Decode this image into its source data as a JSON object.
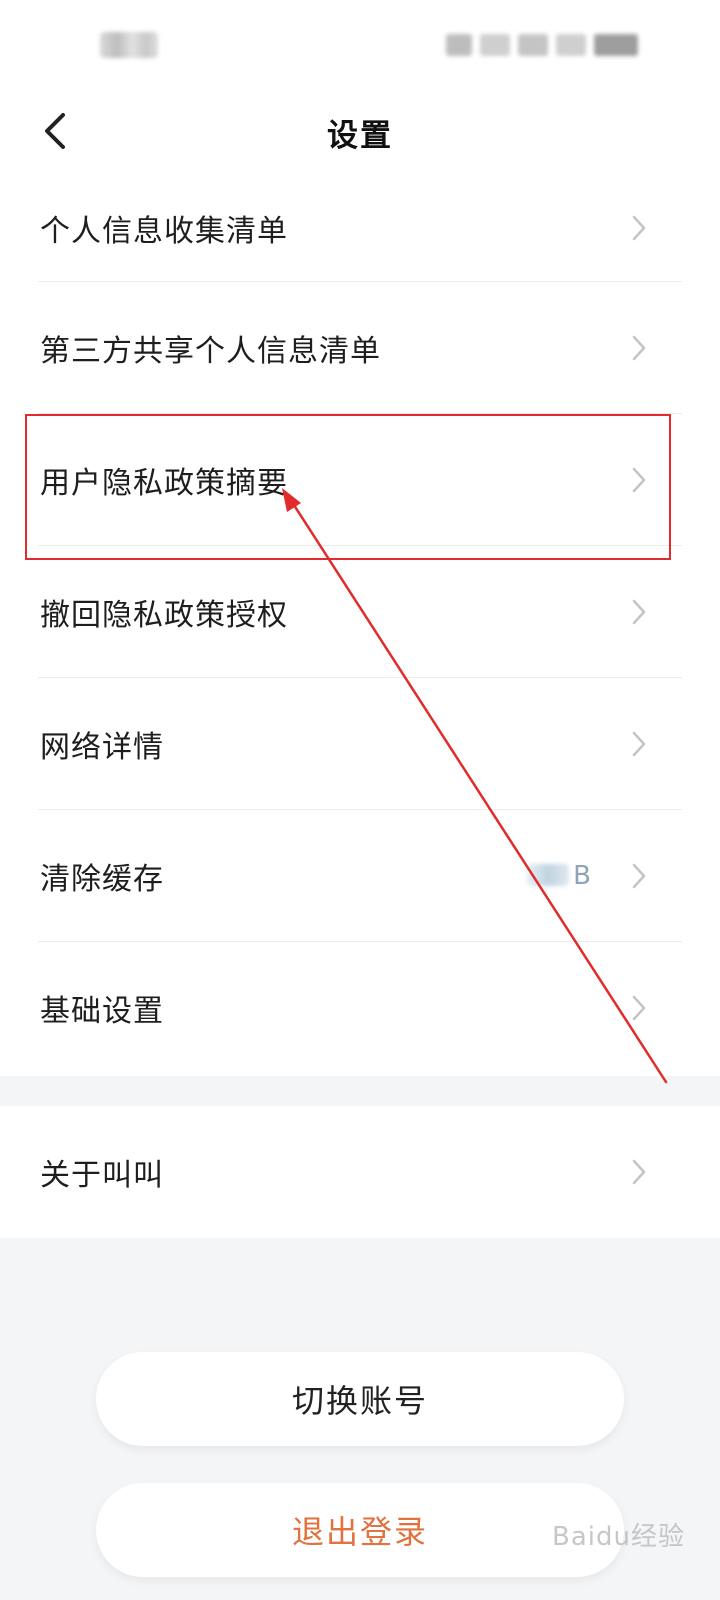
{
  "header": {
    "title": "设置"
  },
  "settings": {
    "items": [
      {
        "label": "个人信息收集清单"
      },
      {
        "label": "第三方共享个人信息清单"
      },
      {
        "label": "用户隐私政策摘要"
      },
      {
        "label": "撤回隐私政策授权"
      },
      {
        "label": "网络详情"
      },
      {
        "label": "清除缓存",
        "value": "B"
      },
      {
        "label": "基础设置"
      }
    ],
    "about": {
      "label": "关于叫叫"
    }
  },
  "buttons": {
    "switch_account": "切换账号",
    "logout": "退出登录"
  },
  "watermark": {
    "text": "Baidu经验"
  },
  "colors": {
    "page_background": "#f4f5f7",
    "logout_text": "#e2723e",
    "annotation_red": "#e22b2b",
    "cache_value": "#8fa4b6"
  },
  "icons": {
    "back": "chevron-left-icon",
    "row_arrow": "chevron-right-icon"
  }
}
